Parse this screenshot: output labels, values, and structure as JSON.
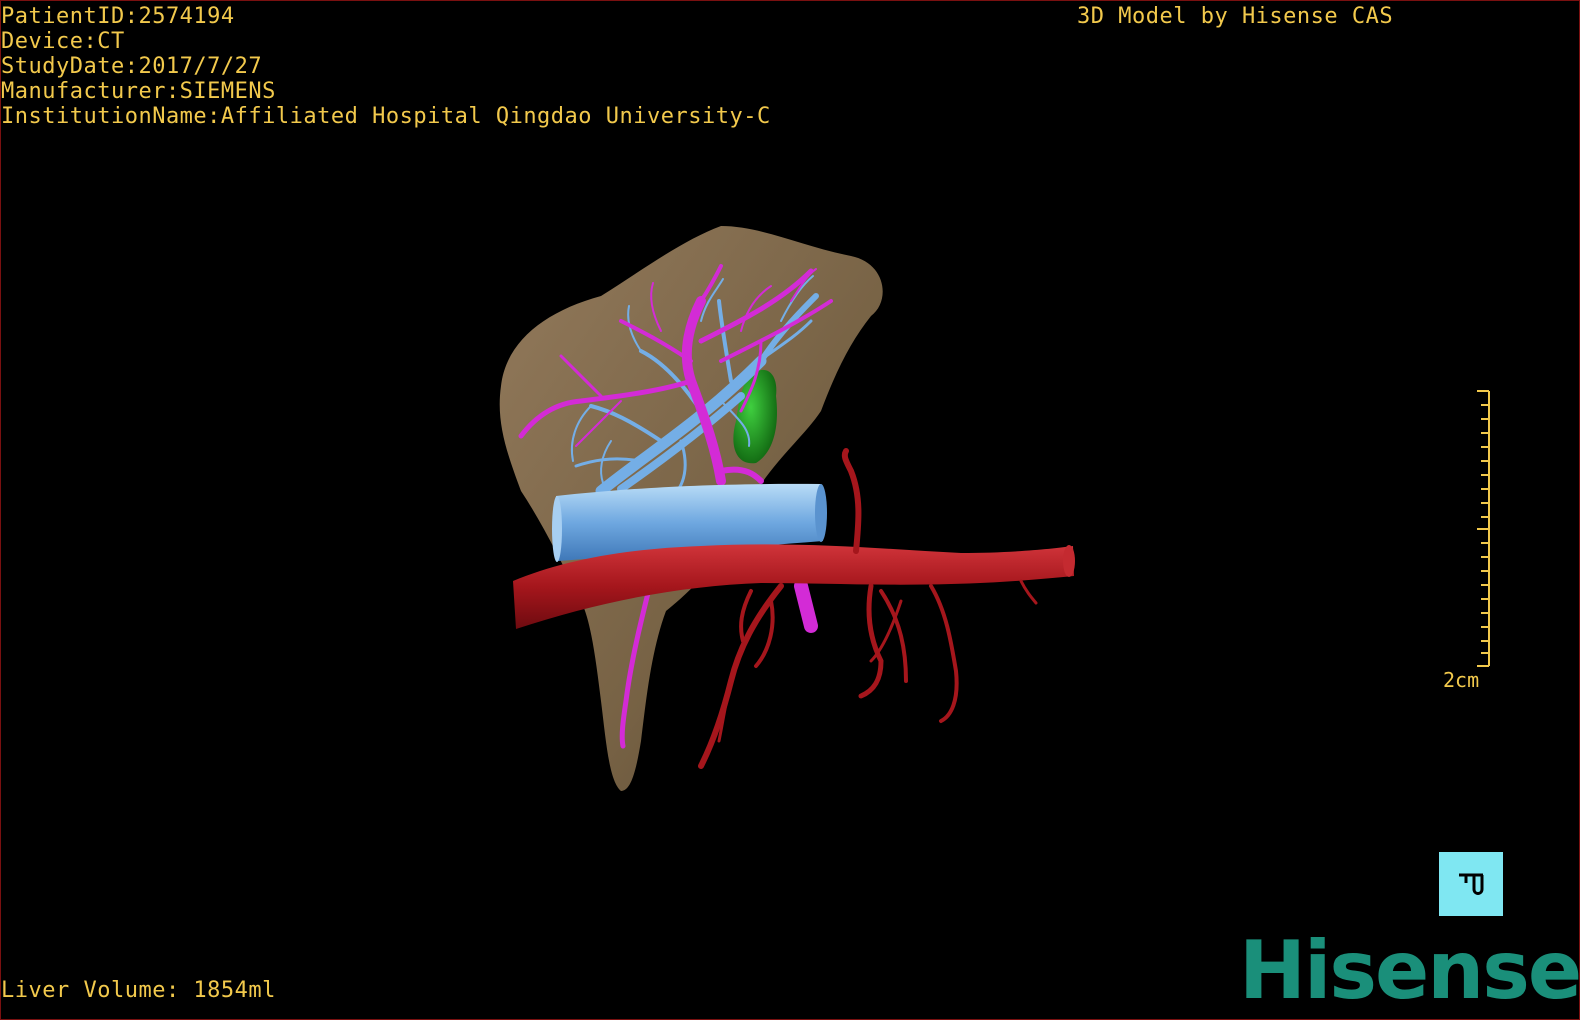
{
  "overlay": {
    "patient_id": "PatientID:2574194",
    "device": "Device:CT",
    "study_date": "StudyDate:2017/7/27",
    "manufacturer": "Manufacturer:SIEMENS",
    "institution": "InstitutionName:Affiliated Hospital Qingdao University-C",
    "watermark": "3D Model by Hisense CAS",
    "liver_volume": "Liver Volume: 1854ml"
  },
  "scale_bar": {
    "label": "2cm"
  },
  "orientation_button": {
    "icon": "orientation-cube-icon"
  },
  "logo": {
    "text": "Hisense"
  },
  "colors": {
    "text": "#f2c94c",
    "liver": "#8a7250",
    "portal_vein": "#d32bd6",
    "hepatic_vein": "#6fa8e0",
    "ivc": "#7fb7ea",
    "artery": "#a5161c",
    "gallbladder": "#1f8a1f",
    "logo": "#1a8f7a",
    "button": "#7fe7f2"
  }
}
